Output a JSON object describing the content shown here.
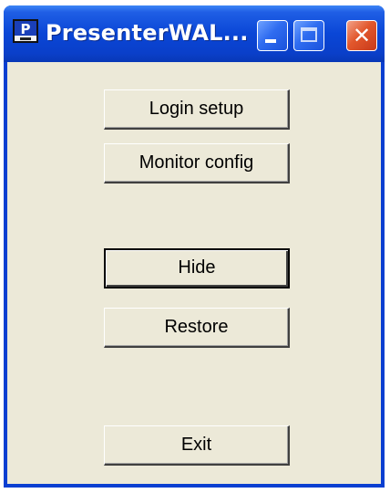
{
  "window": {
    "title": "PresenterWAL...",
    "icon_letter": "P",
    "controls": {
      "minimize": "minimize-icon",
      "maximize": "maximize-icon",
      "close": "close-icon"
    }
  },
  "buttons": {
    "login_setup": "Login setup",
    "monitor_config": "Monitor config",
    "hide": "Hide",
    "restore": "Restore",
    "exit": "Exit"
  },
  "colors": {
    "titlebar": "#0a46d6",
    "client_background": "#ece9d8",
    "close_button": "#e2572c"
  }
}
